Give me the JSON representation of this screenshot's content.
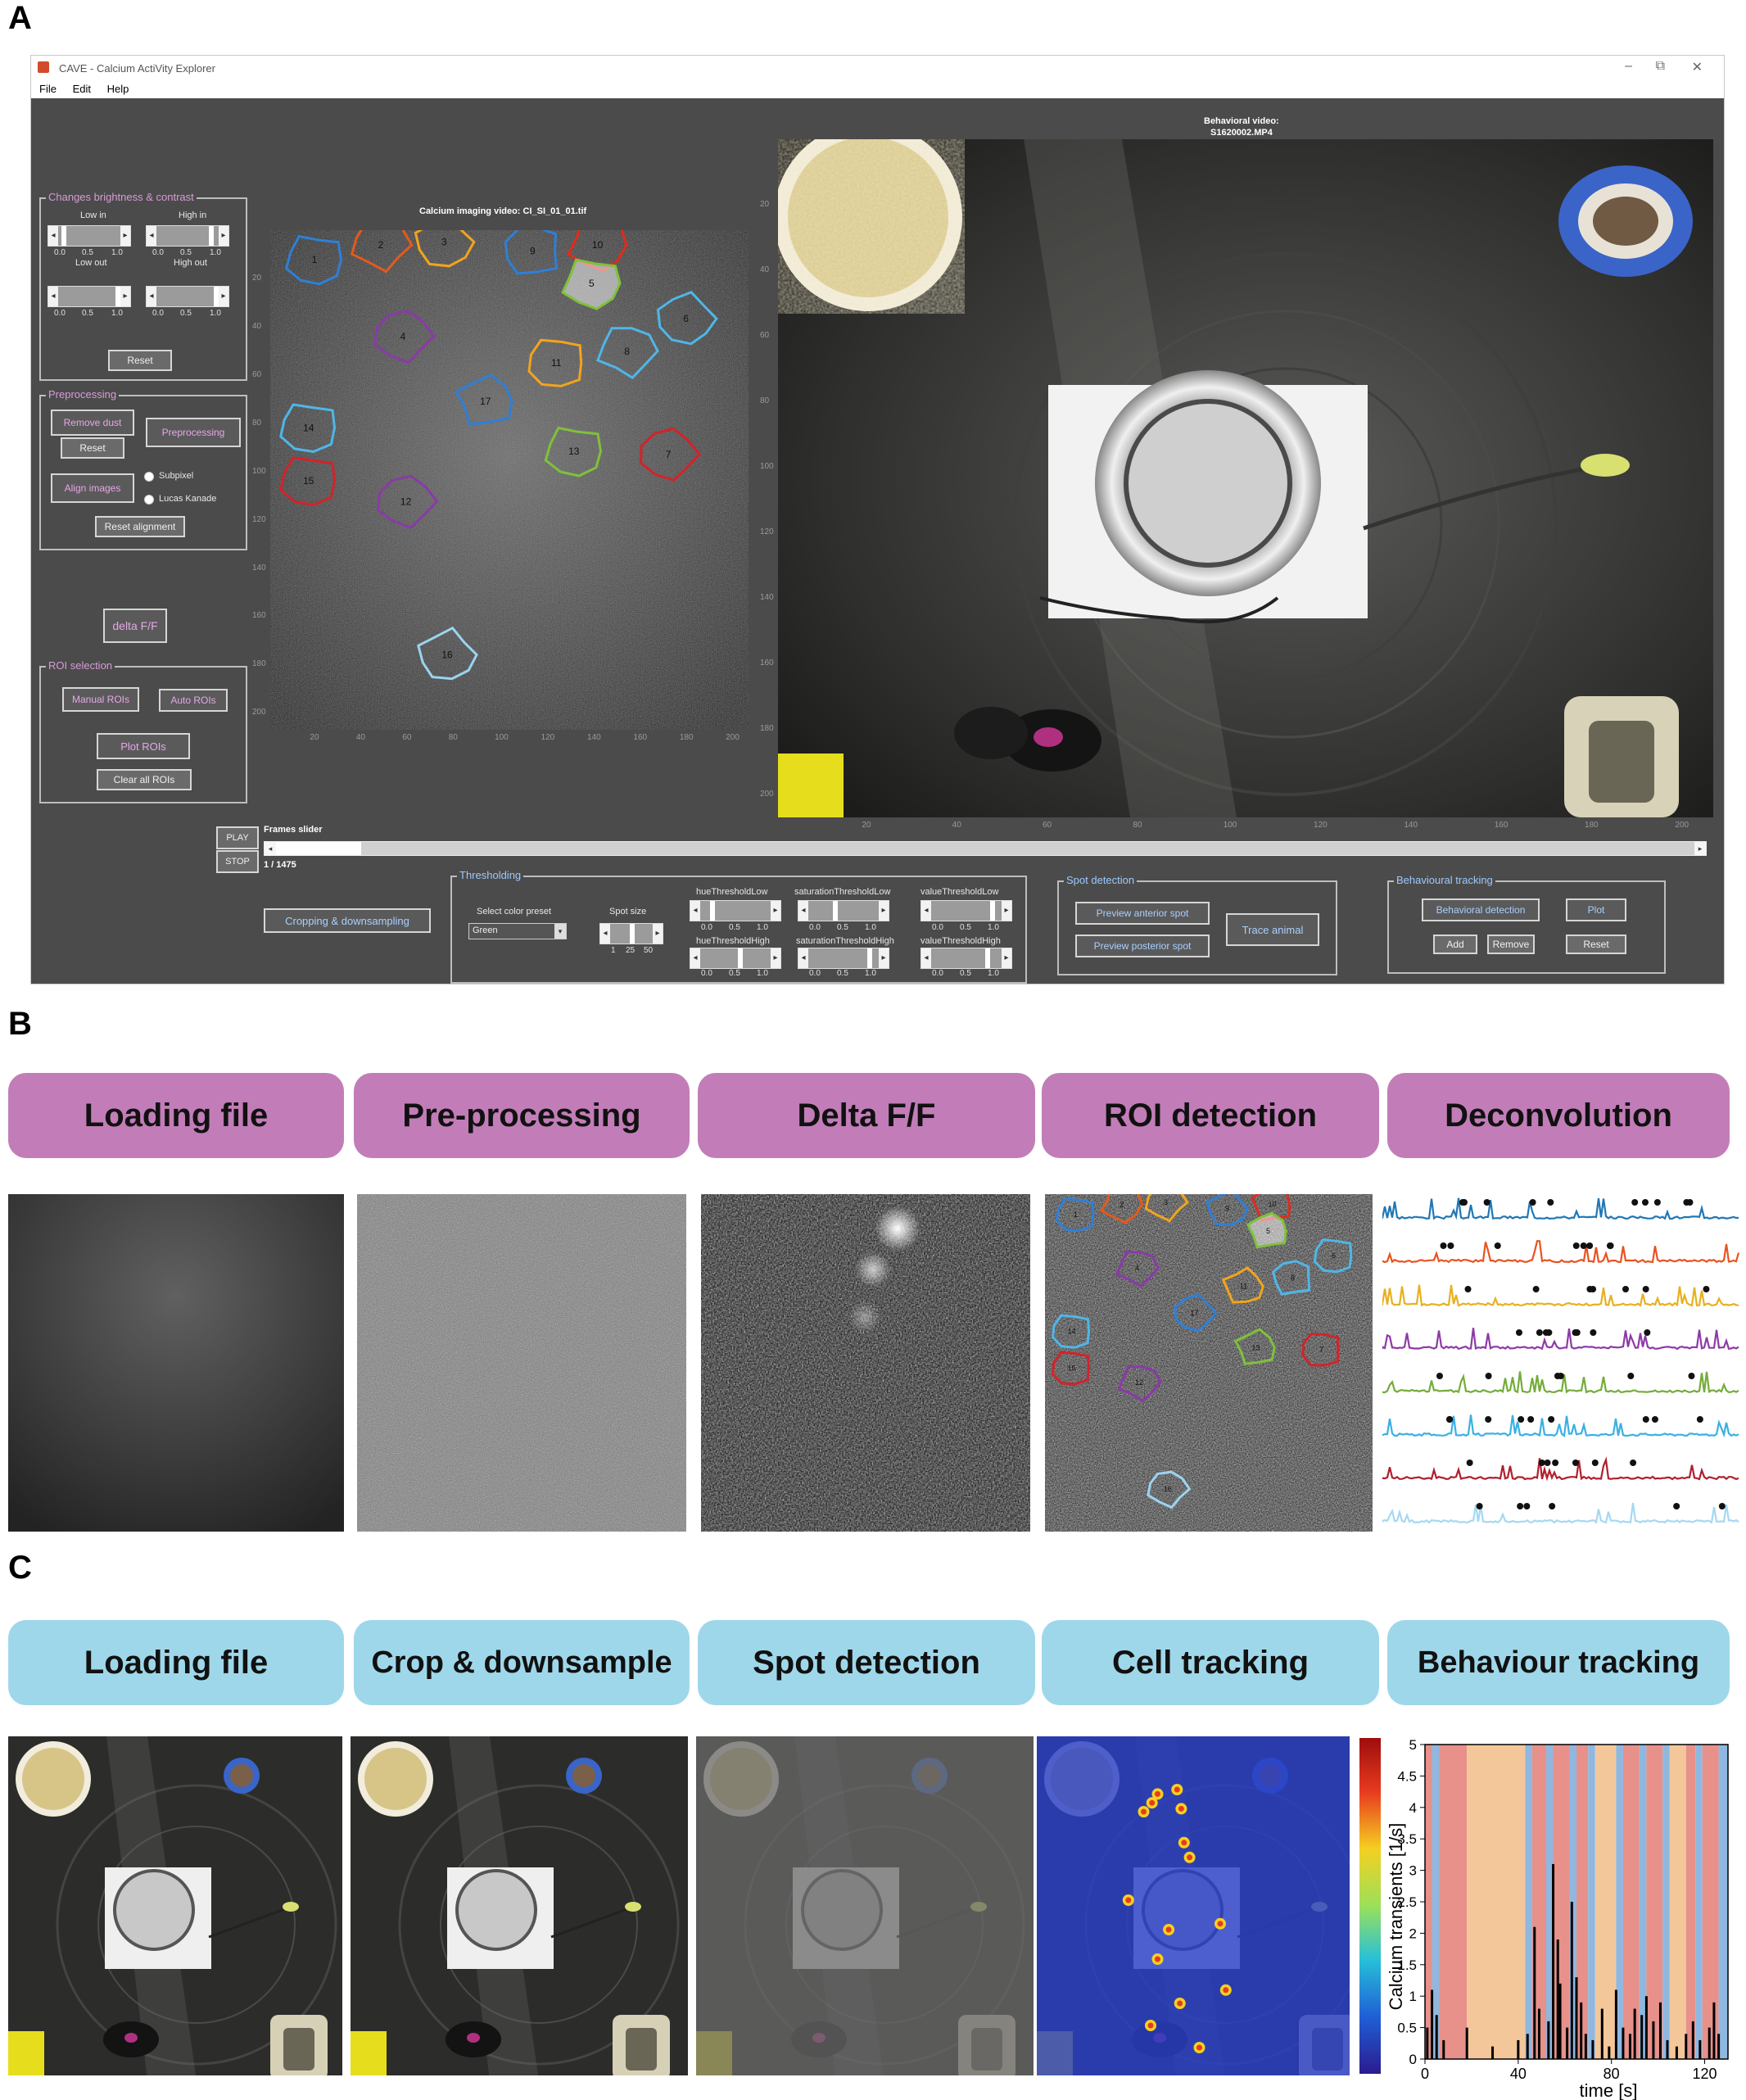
{
  "panels": {
    "a": "A",
    "b": "B",
    "c": "C"
  },
  "window": {
    "title": "CAVE - Calcium ActiVity Explorer",
    "menu": [
      "File",
      "Edit",
      "Help"
    ],
    "minimize": "–",
    "maximize": "⧉",
    "close": "✕"
  },
  "brightness": {
    "title": "Changes brightness & contrast",
    "low_in": "Low in",
    "high_in": "High in",
    "low_out": "Low out",
    "high_out": "High out",
    "ticks_low": [
      "0.0",
      "0.5",
      "1.0"
    ],
    "ticks_high": [
      "0.0",
      "0.5",
      "1.0"
    ],
    "reset": "Reset"
  },
  "preprocessing": {
    "title": "Preprocessing",
    "remove_dust": "Remove dust",
    "reset": "Reset",
    "preprocessing": "Preprocessing",
    "align_images": "Align images",
    "subpixel": "Subpixel",
    "lucas_kanade": "Lucas Kanade",
    "reset_alignment": "Reset alignment"
  },
  "delta": {
    "label": "delta F/F"
  },
  "roi": {
    "title": "ROI selection",
    "manual": "Manual ROIs",
    "auto": "Auto ROIs",
    "plot": "Plot ROIs",
    "clear": "Clear all ROIs"
  },
  "calcium_video": {
    "title": "Calcium imaging video: CI_SI_01_01.tif",
    "xticks": [
      "20",
      "40",
      "60",
      "80",
      "100",
      "120",
      "140",
      "160",
      "180",
      "200"
    ],
    "yticks": [
      "20",
      "40",
      "60",
      "80",
      "100",
      "120",
      "140",
      "160",
      "180",
      "200"
    ],
    "rois": [
      {
        "id": "1",
        "color": "#2f7fd6"
      },
      {
        "id": "2",
        "color": "#e25a1c"
      },
      {
        "id": "3",
        "color": "#f2a41c"
      },
      {
        "id": "9",
        "color": "#2f7fd6"
      },
      {
        "id": "10",
        "color": "#e22a1c"
      },
      {
        "id": "5",
        "color": "#7fc13a"
      },
      {
        "id": "6",
        "color": "#4fb6e8"
      },
      {
        "id": "4",
        "color": "#8a3aa8"
      },
      {
        "id": "11",
        "color": "#f2a41c"
      },
      {
        "id": "8",
        "color": "#4fb6e8"
      },
      {
        "id": "17",
        "color": "#2f7fd6"
      },
      {
        "id": "14",
        "color": "#4fb6e8"
      },
      {
        "id": "13",
        "color": "#7fc13a"
      },
      {
        "id": "7",
        "color": "#d2232a"
      },
      {
        "id": "15",
        "color": "#d2232a"
      },
      {
        "id": "12",
        "color": "#8a3aa8"
      },
      {
        "id": "16",
        "color": "#9ad4f0"
      }
    ]
  },
  "behavior_video": {
    "title": "Behavioral video:",
    "filename": "S1620002.MP4",
    "xticks": [
      "20",
      "40",
      "60",
      "80",
      "100",
      "120",
      "140",
      "160",
      "180",
      "200"
    ],
    "yticks": [
      "20",
      "40",
      "60",
      "80",
      "100",
      "120",
      "140",
      "160",
      "180",
      "200"
    ]
  },
  "playback": {
    "play": "PLAY",
    "stop": "STOP",
    "slider_label": "Frames slider",
    "frame_counter": "1 / 1475",
    "position": 0.06
  },
  "cropping": {
    "label": "Cropping & downsampling"
  },
  "thresholding": {
    "title": "Thresholding",
    "color_preset_label": "Select color preset",
    "color_preset_value": "Green",
    "spot_size": "Spot size",
    "spot_ticks": [
      "1",
      "25",
      "50"
    ],
    "hue_low": "hueThresholdLow",
    "sat_low": "saturationThresholdLow",
    "val_low": "valueThresholdLow",
    "hue_high": "hueThresholdHigh",
    "sat_high": "saturationThresholdHigh",
    "val_high": "valueThresholdHigh",
    "ticks": [
      "0.0",
      "0.5",
      "1.0"
    ]
  },
  "spot_detection": {
    "title": "Spot detection",
    "preview_anterior": "Preview anterior spot",
    "preview_posterior": "Preview posterior spot",
    "trace_animal": "Trace animal"
  },
  "behavioural_tracking": {
    "title": "Behavioural tracking",
    "detection": "Behavioral detection",
    "plot": "Plot",
    "add": "Add",
    "remove": "Remove",
    "reset": "Reset"
  },
  "pipeline_b": [
    "Loading file",
    "Pre-processing",
    "Delta F/F",
    "ROI detection",
    "Deconvolution"
  ],
  "pipeline_c": [
    "Loading file",
    "Crop & downsample",
    "Spot detection",
    "Cell tracking",
    "Behaviour tracking"
  ],
  "deconvolution_traces": [
    {
      "color": "#1f77b4"
    },
    {
      "color": "#e8531f"
    },
    {
      "color": "#e8b01f"
    },
    {
      "color": "#8e3aa5"
    },
    {
      "color": "#74ac3a"
    },
    {
      "color": "#3ab0e2"
    },
    {
      "color": "#b01f2e"
    },
    {
      "color": "#a6d8f2"
    }
  ],
  "cell_tracking_colorbar": {
    "colors": [
      "#2b1b8f",
      "#1f5fd6",
      "#27c0d8",
      "#9be05a",
      "#f5d020",
      "#e83a1f",
      "#9e0d0d"
    ]
  },
  "chart_data": {
    "type": "bar",
    "xlabel": "time [s]",
    "ylabel": "Calcium transients [1/s]",
    "xlim": [
      0,
      130
    ],
    "ylim": [
      0,
      5
    ],
    "xticks": [
      0,
      40,
      80,
      120
    ],
    "yticks": [
      0,
      0.5,
      1,
      1.5,
      2,
      2.5,
      3,
      3.5,
      4,
      4.5,
      5
    ],
    "ytick_labels": [
      "0",
      "0.5",
      "1",
      "1.5",
      "2",
      "2.5",
      "3",
      "3.5",
      "4",
      "4.5",
      "5"
    ],
    "xtick_labels": [
      "0",
      "40",
      "80",
      "120"
    ],
    "background_states": [
      {
        "start": 0,
        "end": 3,
        "color": "#e8908a"
      },
      {
        "start": 3,
        "end": 6,
        "color": "#8fb8e0"
      },
      {
        "start": 6,
        "end": 18,
        "color": "#e8908a"
      },
      {
        "start": 18,
        "end": 43,
        "color": "#f3c79a"
      },
      {
        "start": 43,
        "end": 46,
        "color": "#8fb8e0"
      },
      {
        "start": 46,
        "end": 52,
        "color": "#e8908a"
      },
      {
        "start": 52,
        "end": 55,
        "color": "#8fb8e0"
      },
      {
        "start": 55,
        "end": 62,
        "color": "#e8908a"
      },
      {
        "start": 62,
        "end": 65,
        "color": "#8fb8e0"
      },
      {
        "start": 65,
        "end": 70,
        "color": "#e8908a"
      },
      {
        "start": 70,
        "end": 73,
        "color": "#8fb8e0"
      },
      {
        "start": 73,
        "end": 82,
        "color": "#f3c79a"
      },
      {
        "start": 82,
        "end": 85,
        "color": "#8fb8e0"
      },
      {
        "start": 85,
        "end": 92,
        "color": "#e8908a"
      },
      {
        "start": 92,
        "end": 95,
        "color": "#8fb8e0"
      },
      {
        "start": 95,
        "end": 102,
        "color": "#e8908a"
      },
      {
        "start": 102,
        "end": 105,
        "color": "#8fb8e0"
      },
      {
        "start": 105,
        "end": 112,
        "color": "#f3c79a"
      },
      {
        "start": 112,
        "end": 116,
        "color": "#e8908a"
      },
      {
        "start": 116,
        "end": 119,
        "color": "#8fb8e0"
      },
      {
        "start": 119,
        "end": 126,
        "color": "#e8908a"
      },
      {
        "start": 126,
        "end": 130,
        "color": "#8fb8e0"
      }
    ],
    "transients": [
      {
        "t": 1,
        "v": 0.5
      },
      {
        "t": 3,
        "v": 1.1
      },
      {
        "t": 5,
        "v": 0.7
      },
      {
        "t": 8,
        "v": 0.3
      },
      {
        "t": 18,
        "v": 0.5
      },
      {
        "t": 29,
        "v": 0.2
      },
      {
        "t": 40,
        "v": 0.3
      },
      {
        "t": 44,
        "v": 0.4
      },
      {
        "t": 47,
        "v": 2.1
      },
      {
        "t": 49,
        "v": 0.8
      },
      {
        "t": 53,
        "v": 0.6
      },
      {
        "t": 55,
        "v": 3.1
      },
      {
        "t": 57,
        "v": 1.9
      },
      {
        "t": 58,
        "v": 1.2
      },
      {
        "t": 61,
        "v": 0.5
      },
      {
        "t": 63,
        "v": 2.5
      },
      {
        "t": 65,
        "v": 1.3
      },
      {
        "t": 67,
        "v": 0.9
      },
      {
        "t": 69,
        "v": 0.4
      },
      {
        "t": 72,
        "v": 0.3
      },
      {
        "t": 76,
        "v": 0.8
      },
      {
        "t": 79,
        "v": 0.2
      },
      {
        "t": 82,
        "v": 1.1
      },
      {
        "t": 85,
        "v": 0.5
      },
      {
        "t": 88,
        "v": 0.4
      },
      {
        "t": 90,
        "v": 0.8
      },
      {
        "t": 93,
        "v": 0.7
      },
      {
        "t": 95,
        "v": 1.0
      },
      {
        "t": 98,
        "v": 0.6
      },
      {
        "t": 101,
        "v": 0.9
      },
      {
        "t": 104,
        "v": 0.3
      },
      {
        "t": 108,
        "v": 0.2
      },
      {
        "t": 112,
        "v": 0.4
      },
      {
        "t": 115,
        "v": 0.6
      },
      {
        "t": 118,
        "v": 0.3
      },
      {
        "t": 122,
        "v": 0.5
      },
      {
        "t": 124,
        "v": 0.9
      },
      {
        "t": 126,
        "v": 0.4
      }
    ]
  }
}
